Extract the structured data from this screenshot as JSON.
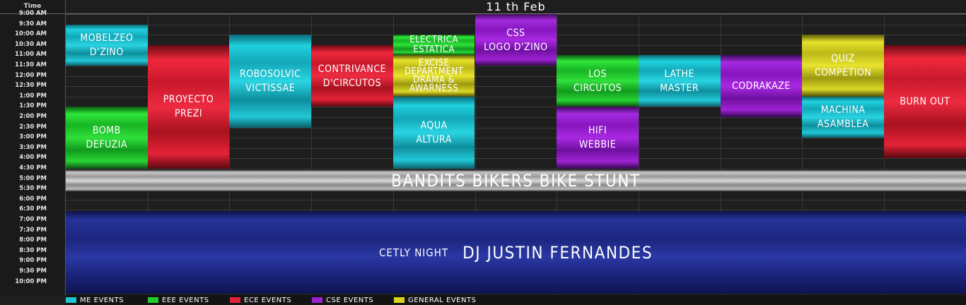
{
  "header": {
    "time_label": "Time",
    "day_label": "11 th Feb"
  },
  "times": [
    "9:00 AM",
    "9:30 AM",
    "10:00 AM",
    "10:30 AM",
    "11:00 AM",
    "11:30 AM",
    "12:00 PM",
    "12:30 PM",
    "1:00 PM",
    "1:30 PM",
    "2:00 PM",
    "2:30 PM",
    "3:00 PM",
    "3:30 PM",
    "4:00 PM",
    "4:30 PM",
    "5:00 PM",
    "5:30 PM",
    "6:00 PM",
    "6:30 PM",
    "7:00 PM",
    "7:30 PM",
    "8:00 PM",
    "8:30 PM",
    "9:00 PM",
    "9:30 PM",
    "10:00 PM"
  ],
  "events": [
    {
      "id": "mobelzeo",
      "label": "MOBELZEO\nD'ZINO",
      "category": "ME",
      "start": "9:30 AM",
      "end": "11:30 AM"
    },
    {
      "id": "bomb",
      "label": "BOMB\nDEFUZIA",
      "category": "EEE",
      "start": "1:30 PM",
      "end": "4:30 PM"
    },
    {
      "id": "proyecto",
      "label": "PROYECTO\nPREZI",
      "category": "ECE",
      "start": "10:30 AM",
      "end": "4:30 PM"
    },
    {
      "id": "robosolvic",
      "label": "ROBOSOLVIC\nVICTISSAE",
      "category": "ME",
      "start": "10:00 AM",
      "end": "2:30 PM"
    },
    {
      "id": "contrivance",
      "label": "CONTRIVANCE\nD'CIRCUTOS",
      "category": "ECE",
      "start": "10:30 AM",
      "end": "1:30 PM"
    },
    {
      "id": "electrica",
      "label": "ELECTRICA\nESTATICA",
      "category": "EEE",
      "start": "10:00 AM",
      "end": "11:00 AM"
    },
    {
      "id": "excise",
      "label": "EXCISE\nDEPARTMENT\nDRAMA &\nAWARNESS",
      "category": "GENERAL",
      "start": "11:00 AM",
      "end": "1:00 PM"
    },
    {
      "id": "aqua",
      "label": "AQUA\nALTURA",
      "category": "ME",
      "start": "1:00 PM",
      "end": "4:30 PM"
    },
    {
      "id": "css",
      "label": "CSS\nLOGO D'ZINO",
      "category": "CSE",
      "start": "9:00 AM",
      "end": "11:30 AM"
    },
    {
      "id": "circutos",
      "label": "LOS\nCIRCUTOS",
      "category": "EEE",
      "start": "11:00 AM",
      "end": "1:30 PM"
    },
    {
      "id": "hifi",
      "label": "HIFI\nWEBBIE",
      "category": "CSE",
      "start": "1:30 PM",
      "end": "4:30 PM"
    },
    {
      "id": "lathe",
      "label": "LATHE\nMASTER",
      "category": "ME",
      "start": "11:00 AM",
      "end": "1:30 PM"
    },
    {
      "id": "codrakaze",
      "label": "CODRAKAZE",
      "category": "CSE",
      "start": "11:00 AM",
      "end": "2:00 PM"
    },
    {
      "id": "quiz",
      "label": "QUIZ\nCOMPETION",
      "category": "GENERAL",
      "start": "10:00 AM",
      "end": "1:00 PM"
    },
    {
      "id": "machina",
      "label": "MACHINA\nASAMBLEA",
      "category": "ME",
      "start": "1:00 PM",
      "end": "3:00 PM"
    },
    {
      "id": "burnout",
      "label": "BURN OUT",
      "category": "ECE",
      "start": "10:30 AM",
      "end": "4:00 PM"
    }
  ],
  "stunt": {
    "label": "BANDITS BIKERS BIKE STUNT",
    "start": "4:30 PM",
    "end": "6:30 PM"
  },
  "night": {
    "prefix": "CETLY NIGHT",
    "headline": "DJ JUSTIN FERNANDES",
    "start": "6:30 PM",
    "end": "10:00 PM"
  },
  "legend": [
    {
      "label": "ME EVENTS",
      "color": "#1fc3d1"
    },
    {
      "label": "EEE EVENTS",
      "color": "#23cf2f"
    },
    {
      "label": "ECE EVENTS",
      "color": "#e0213a"
    },
    {
      "label": "CSE EVENTS",
      "color": "#9a22d0"
    },
    {
      "label": "GENERAL EVENTS",
      "color": "#d8d424"
    }
  ]
}
